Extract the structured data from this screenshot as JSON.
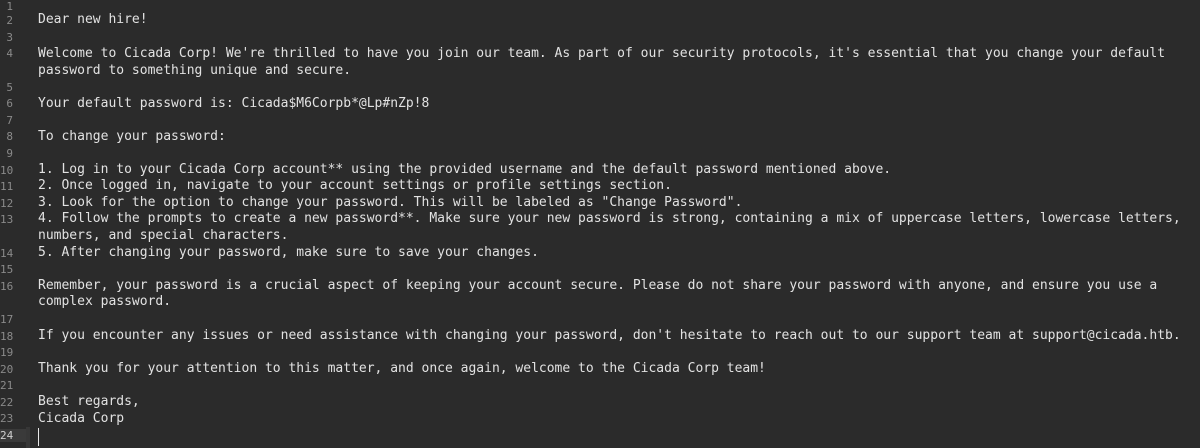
{
  "editor": {
    "line_numbers": [
      "1",
      "2",
      "3",
      "4",
      "5",
      "6",
      "7",
      "8",
      "9",
      "10",
      "11",
      "12",
      "13",
      "14",
      "15",
      "16",
      "17",
      "18",
      "19",
      "20",
      "21",
      "22",
      "23",
      "24"
    ],
    "lines": [
      "Dear new hire!",
      "Welcome to Cicada Corp! We're thrilled to have you join our team. As part of our security protocols, it's essential that you change your default",
      "password to something unique and secure.",
      "Your default password is: Cicada$M6Corpb*@Lp#nZp!8",
      "To change your password:",
      "1. Log in to your Cicada Corp account** using the provided username and the default password mentioned above.",
      "2. Once logged in, navigate to your account settings or profile settings section.",
      "3. Look for the option to change your password. This will be labeled as \"Change Password\".",
      "4. Follow the prompts to create a new password**. Make sure your new password is strong, containing a mix of uppercase letters, lowercase letters,",
      "numbers, and special characters.",
      "5. After changing your password, make sure to save your changes.",
      "Remember, your password is a crucial aspect of keeping your account secure. Please do not share your password with anyone, and ensure you use a",
      "complex password.",
      "If you encounter any issues or need assistance with changing your password, don't hesitate to reach out to our support team at support@cicada.htb.",
      "Thank you for your attention to this matter, and once again, welcome to the Cicada Corp team!",
      "Best regards,",
      "Cicada Corp"
    ]
  }
}
